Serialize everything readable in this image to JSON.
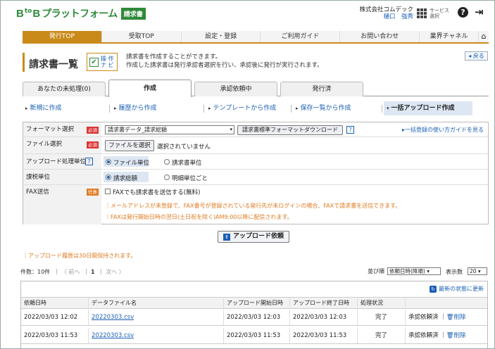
{
  "header": {
    "logo_b": "B",
    "logo_to": "to",
    "logo_b2": "B",
    "logo_name": "プラットフォーム",
    "logo_badge": "請求書",
    "company": "株式会社コムデック",
    "user": "樋口　強秀",
    "service_label1": "サービス",
    "service_label2": "選択",
    "help_icon": "?",
    "exit_icon": "⇥"
  },
  "nav": {
    "items": [
      "発行TOP",
      "受取TOP",
      "設定・登録",
      "ご利用ガイド",
      "お問い合わせ",
      "業界チャネル"
    ],
    "home_icon": "⌂",
    "active_index": 0
  },
  "page": {
    "title": "請求書一覧",
    "nav_badge_check": "✔",
    "nav_badge_line1": "操 作",
    "nav_badge_line2": "ナ ビ",
    "desc1": "請求書を作成することができます。",
    "desc2": "作成した請求書は発行承認者選択を行い、承認後に発行が実行されます。",
    "back": "◂ 戻る"
  },
  "tabs": [
    "あなたの未処理(0)",
    "作成",
    "承認依頼中",
    "発行済"
  ],
  "subtabs": [
    "新規に作成",
    "履歴から作成",
    "テンプレートから作成",
    "保存一覧から作成",
    "一括アップロード作成"
  ],
  "form": {
    "format_label": "フォーマット選択",
    "required": "必須",
    "optional": "任意",
    "format_value": "請求書データ_請求総額",
    "format_dl_button": "請求書標準フォーマットダウンロード",
    "howto_link": "一括登録の使い方ガイドを見る",
    "file_label": "ファイル選択",
    "file_button": "ファイルを選択",
    "file_status": "選択されていません",
    "unit_label": "アップロード処理単位",
    "unit_opt1": "ファイル単位",
    "unit_opt2": "請求書単位",
    "tax_label": "課税単位",
    "tax_opt1": "請求総額",
    "tax_opt2": "明細単位ごと",
    "fax_label": "FAX送信",
    "fax_check": "FAXでも請求書を送信する(無料)",
    "fax_note1": "メールアドレスが未登録で、FAX番号が登録されている発行先が未ログインの場合、FAXで請求書を送信できます。",
    "fax_note2": "FAXは発行開始日時の翌日(土日祝を除く)AM9:00以降に配信されます。",
    "q": "?"
  },
  "upload_button": "アップロード依頼",
  "upload_icon": "⇧",
  "note": "アップロード履歴は30日間保持されます。",
  "pager": {
    "count": "件数：10件",
    "prev": "〈 前へ",
    "page": "1",
    "next": "次へ 〉",
    "sort_label": "並び順",
    "sort_value": "依頼日時(降順)",
    "per_page_label": "表示数",
    "per_page_value": "20"
  },
  "list": {
    "refresh": "最新の状態に更新",
    "refresh_icon": "↻",
    "headers": [
      "依頼日時",
      "データファイル名",
      "アップロード開始日時",
      "アップロード終了日時",
      "処理状況",
      ""
    ],
    "rows": [
      {
        "requested": "2022/03/03 12:02",
        "file": "20220303.csv",
        "start": "2022/03/03 12:03",
        "end": "2022/03/03 12:03",
        "status": "完了",
        "action": "承認依頼済",
        "delete": "削除"
      },
      {
        "requested": "2022/03/03 11:53",
        "file": "20220303.csv",
        "start": "2022/03/03 11:53",
        "end": "2022/03/03 11:53",
        "status": "完了",
        "action": "承認依頼済",
        "delete": "削除"
      }
    ]
  },
  "colors": {
    "accent": "#c98a1a",
    "brand": "#2f8a3a",
    "link": "#1a5fb4"
  }
}
